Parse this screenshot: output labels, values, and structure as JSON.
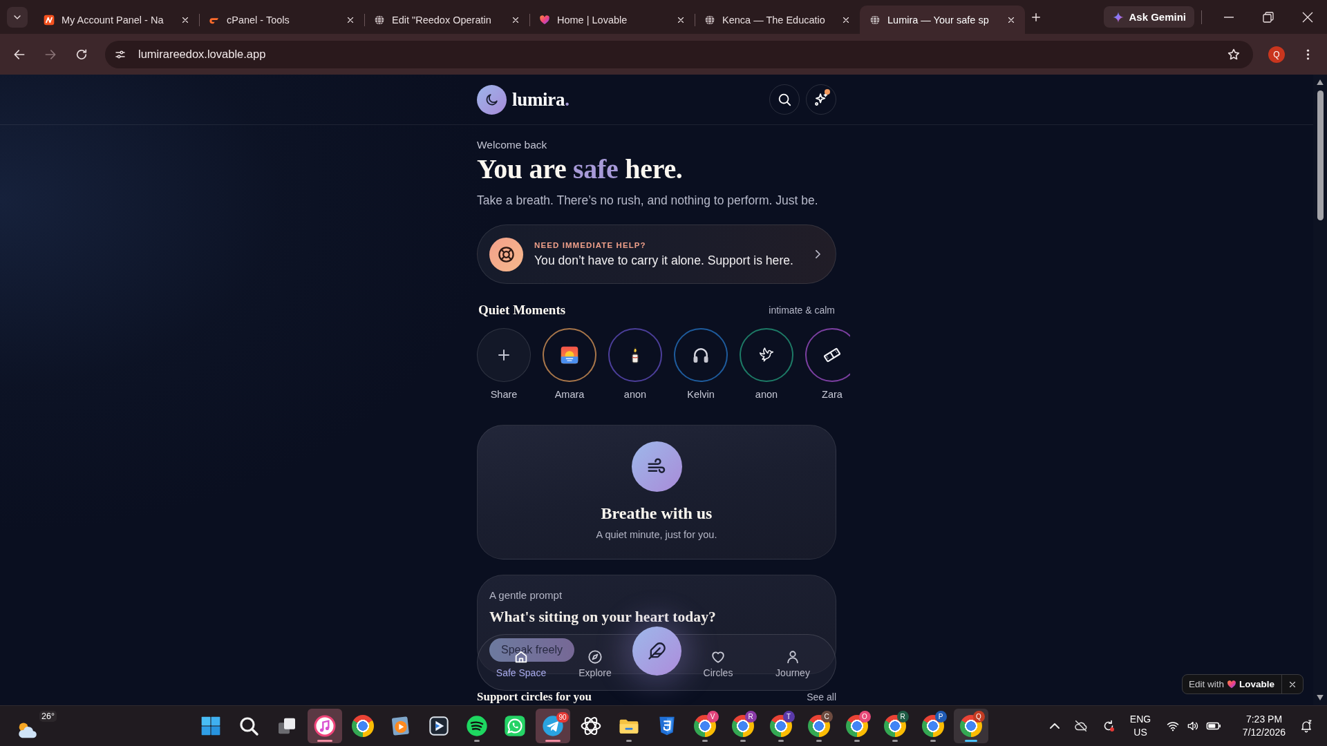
{
  "browser": {
    "tabs": [
      {
        "kind": "badge",
        "title": "My Account Panel - Na",
        "selected": false
      },
      {
        "kind": "logo",
        "title": "cPanel - Tools",
        "selected": false
      },
      {
        "kind": "globe",
        "title": "Edit \"Reedox Operatin",
        "selected": false
      },
      {
        "kind": "heart",
        "title": "Home | Lovable",
        "selected": false
      },
      {
        "kind": "globe",
        "title": "Kenca — The Educatio",
        "selected": false
      },
      {
        "kind": "globe",
        "title": "Lumira — Your safe sp",
        "selected": true
      }
    ],
    "gemini": "Ask Gemini",
    "forward_disabled": true,
    "url": "lumirareedox.lovable.app",
    "profile": "Q"
  },
  "app": {
    "brand": "lumira",
    "brand_dot": ".",
    "notify": true,
    "welcome": "Welcome back",
    "headline": {
      "before": "You are",
      "accent": "safe",
      "after": "here."
    },
    "intro": "Take a breath. There’s no rush, and nothing to perform. Just be.",
    "help": {
      "eyebrow": "NEED IMMEDIATE HELP?",
      "text": "You don’t have to carry it alone. Support is here."
    },
    "moments": {
      "title": "Quiet Moments",
      "note": "intimate & calm",
      "items": [
        {
          "kind": "share",
          "label": "Share"
        },
        {
          "kind": "story",
          "label": "Amara",
          "color": "#a8764a"
        },
        {
          "kind": "story",
          "label": "anon",
          "color": "#4b3e99"
        },
        {
          "kind": "story",
          "label": "Kelvin",
          "color": "#1e5b9c"
        },
        {
          "kind": "story",
          "label": "anon",
          "color": "#1d7a66"
        },
        {
          "kind": "story",
          "label": "Zara",
          "color": "#7b3fa0"
        }
      ]
    },
    "breathe": {
      "title": "Breathe with us",
      "text": "A quiet minute, just for you."
    },
    "prompt": {
      "eyebrow": "A gentle prompt",
      "question": "What's sitting on your heart today?",
      "button": "Speak freely"
    },
    "next": {
      "title": "Support circles for you",
      "link": "See all"
    },
    "nav": [
      {
        "label": "Safe Space",
        "selected": true
      },
      {
        "label": "Explore",
        "selected": false
      },
      {
        "label": "Circles",
        "selected": false
      },
      {
        "label": "Journey",
        "selected": false
      }
    ],
    "edit_badge": {
      "prefix": "Edit with",
      "brand": "Lovable"
    }
  },
  "taskbar": {
    "weather": "26°",
    "apps": [
      {
        "kind": "music",
        "open": true,
        "attention": true,
        "selected": false
      },
      {
        "kind": "browser",
        "open": false,
        "attention": false,
        "selected": false
      },
      {
        "kind": "video",
        "open": false,
        "attention": false,
        "selected": false
      },
      {
        "kind": "player",
        "open": false,
        "attention": false,
        "selected": false
      },
      {
        "kind": "audio",
        "open": true,
        "attention": false,
        "selected": false
      },
      {
        "kind": "chat",
        "open": false,
        "attention": false,
        "selected": false
      },
      {
        "kind": "messenger",
        "open": true,
        "attention": true,
        "selected": false,
        "badge": "90"
      },
      {
        "kind": "assistant",
        "open": false,
        "attention": false,
        "selected": false
      },
      {
        "kind": "folder",
        "open": true,
        "attention": false,
        "selected": false
      },
      {
        "kind": "shield",
        "open": false,
        "attention": false,
        "selected": false
      },
      {
        "kind": "browser",
        "open": true,
        "attention": false,
        "selected": false,
        "badge": "V",
        "color": "#e2457b"
      },
      {
        "kind": "browser",
        "open": true,
        "attention": false,
        "selected": false,
        "badge": "R",
        "color": "#8a3aa8"
      },
      {
        "kind": "browser",
        "open": true,
        "attention": false,
        "selected": false,
        "badge": "T",
        "color": "#5a39a8"
      },
      {
        "kind": "browser",
        "open": true,
        "attention": false,
        "selected": false,
        "badge": "C",
        "color": "#6e4b3f"
      },
      {
        "kind": "browser",
        "open": true,
        "attention": false,
        "selected": false,
        "badge": "O",
        "color": "#e84a79"
      },
      {
        "kind": "browser",
        "open": true,
        "attention": false,
        "selected": false,
        "badge": "R",
        "color": "#1e5c45"
      },
      {
        "kind": "browser",
        "open": true,
        "attention": false,
        "selected": false,
        "badge": "P",
        "color": "#1f5bb5"
      },
      {
        "kind": "browser",
        "open": true,
        "attention": false,
        "selected": true,
        "badge": "Q",
        "color": "#c23b22"
      }
    ],
    "tray": {
      "lang": "ENG",
      "region": "US",
      "time": "7:23 PM",
      "date": "7/12/2026"
    }
  }
}
